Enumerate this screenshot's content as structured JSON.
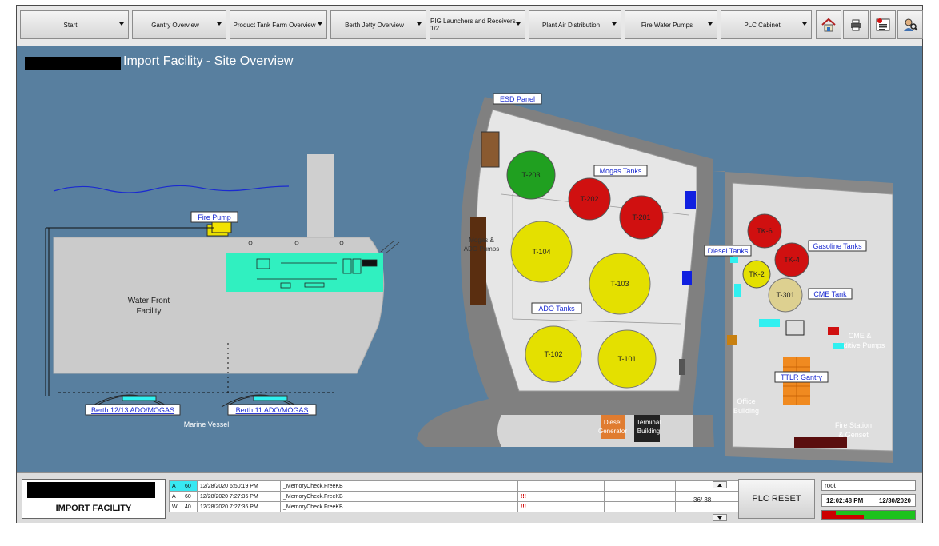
{
  "nav": {
    "items": [
      {
        "label": "Start"
      },
      {
        "label": "Gantry Overview"
      },
      {
        "label": "Product Tank Farm Overview"
      },
      {
        "label": "Berth Jetty Overview"
      },
      {
        "label": "PIG Launchers and Receivers 1/2"
      },
      {
        "label": "Plant Air Distribution"
      },
      {
        "label": "Fire Water Pumps"
      },
      {
        "label": "PLC Cabinet"
      }
    ],
    "icons": [
      "home-icon",
      "print-icon",
      "alarm-list-icon",
      "user-login-icon"
    ]
  },
  "page": {
    "title": "Import Facility - Site Overview"
  },
  "map": {
    "left": {
      "fire_pump": "Fire Pump",
      "water_front_line1": "Water Front",
      "water_front_line2": "Facility",
      "berth_1213": "Berth 12/13 ADO/MOGAS",
      "berth_11": "Berth 11 ADO/MOGAS",
      "marine_vessel": "Marine Vessel"
    },
    "right": {
      "esd_panel": "ESD Panel",
      "mogas_tanks": "Mogas Tanks",
      "ado_tanks": "ADO Tanks",
      "pumps_line1": "Mogas &",
      "pumps_line2": "ADO Pumps",
      "diesel_tanks": "Diesel Tanks",
      "gasoline_tanks": "Gasoline Tanks",
      "cme_tank": "CME Tank",
      "cme_pumps_line1": "CME &",
      "cme_pumps_line2": "Additive Pumps",
      "ttlr_gantry": "TTLR Gantry",
      "office_line1": "Office",
      "office_line2": "Building",
      "fire_station_line1": "Fire Station",
      "fire_station_line2": "& Genset",
      "diesel_gen_line1": "Diesel",
      "diesel_gen_line2": "Generator",
      "terminal_line1": "Terminal",
      "terminal_line2": "Building"
    },
    "tanks": {
      "t203": "T-203",
      "t202": "T-202",
      "t201": "T-201",
      "t104": "T-104",
      "t103": "T-103",
      "t102": "T-102",
      "t101": "T-101",
      "tk6": "TK-6",
      "tk4": "TK-4",
      "tk2": "TK-2",
      "t301": "T-301"
    },
    "colors": {
      "green": "#20a020",
      "red": "#d01010",
      "yellow": "#e4e000",
      "tan": "#ddd090",
      "cyan": "#30f0c0",
      "water": "#587f9f"
    }
  },
  "status": {
    "facility": "IMPORT FACILITY",
    "alarms": [
      {
        "type": "A",
        "priority": "60",
        "timestamp": "12/28/2020 6:50:19 PM",
        "tag": "_MemoryCheck.FreeKB",
        "flag": ""
      },
      {
        "type": "A",
        "priority": "60",
        "timestamp": "12/28/2020 7:27:36 PM",
        "tag": "_MemoryCheck.FreeKB",
        "flag": "!!!"
      },
      {
        "type": "W",
        "priority": "40",
        "timestamp": "12/28/2020 7:27:36 PM",
        "tag": "_MemoryCheck.FreeKB",
        "flag": "!!!"
      }
    ],
    "page_count": "36/ 38",
    "plc_reset": "PLC RESET",
    "user": "root",
    "time": "12:02:48 PM",
    "date": "12/30/2020",
    "meter_pct": [
      0.85,
      0.55
    ]
  }
}
